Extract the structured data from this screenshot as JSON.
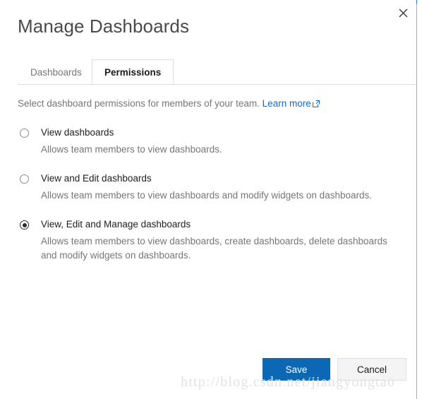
{
  "dialog": {
    "title": "Manage Dashboards",
    "close_label": "Close"
  },
  "tabs": [
    {
      "label": "Dashboards",
      "active": false
    },
    {
      "label": "Permissions",
      "active": true
    }
  ],
  "description": {
    "text": "Select dashboard permissions for members of your team.",
    "link_label": "Learn more",
    "link_icon": "external-link-icon"
  },
  "permissions": {
    "options": [
      {
        "label": "View dashboards",
        "description": "Allows team members to view dashboards.",
        "selected": false
      },
      {
        "label": "View and Edit dashboards",
        "description": "Allows team members to view dashboards and modify widgets on dashboards.",
        "selected": false
      },
      {
        "label": "View, Edit and Manage dashboards",
        "description": "Allows team members to view dashboards, create dashboards, delete dashboards and modify widgets on dashboards.",
        "selected": true
      }
    ]
  },
  "footer": {
    "save_label": "Save",
    "cancel_label": "Cancel"
  },
  "watermark": {
    "text": "http://blog.csdn.net/jiangyongtao"
  },
  "colors": {
    "primary": "#0c68b5",
    "link": "#166bc4",
    "muted_text": "#767676",
    "body_text": "#212121",
    "border": "#dcdcdc"
  }
}
